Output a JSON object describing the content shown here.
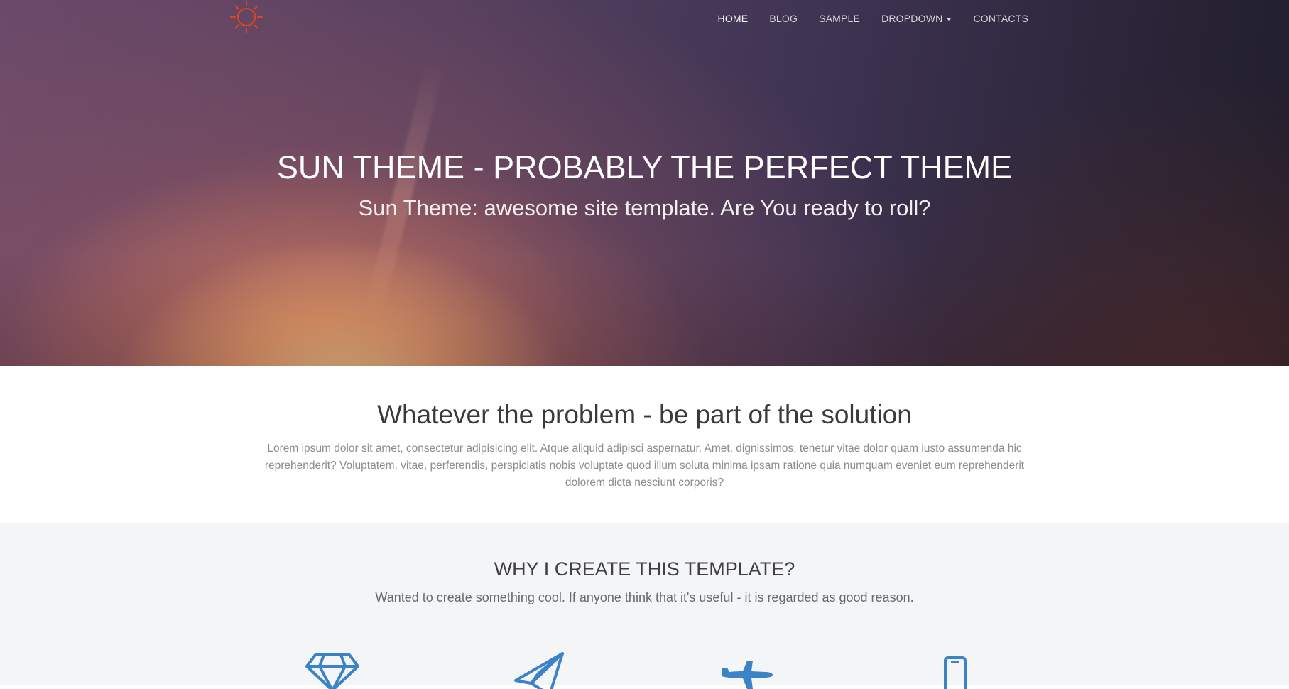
{
  "nav": {
    "items": [
      "HOME",
      "BLOG",
      "SAMPLE",
      "DROPDOWN",
      "CONTACTS"
    ]
  },
  "hero": {
    "title": "SUN THEME - PROBABLY THE PERFECT THEME",
    "subtitle": "Sun Theme: awesome site template. Are You ready to roll?"
  },
  "intro": {
    "heading": "Whatever the problem - be part of the solution",
    "body": "Lorem ipsum dolor sit amet, consectetur adipisicing elit. Atque aliquid adipisci aspernatur. Amet, dignissimos, tenetur vitae dolor quam iusto assumenda hic reprehenderit? Voluptatem, vitae, perferendis, perspiciatis nobis voluptate quod illum soluta minima ipsam ratione quia numquam eveniet eum reprehenderit dolorem dicta nesciunt corporis?"
  },
  "features": {
    "heading": "WHY I CREATE THIS TEMPLATE?",
    "lead": "Wanted to create something cool. If anyone think that it's useful - it is regarded as good reason.",
    "icons": [
      "diamond-icon",
      "paper-plane-icon",
      "jet-icon",
      "mobile-phone-icon"
    ]
  },
  "colors": {
    "logo": "#e0451f",
    "icon_accent": "#3b83c6",
    "section_bg": "#f4f5f7"
  }
}
